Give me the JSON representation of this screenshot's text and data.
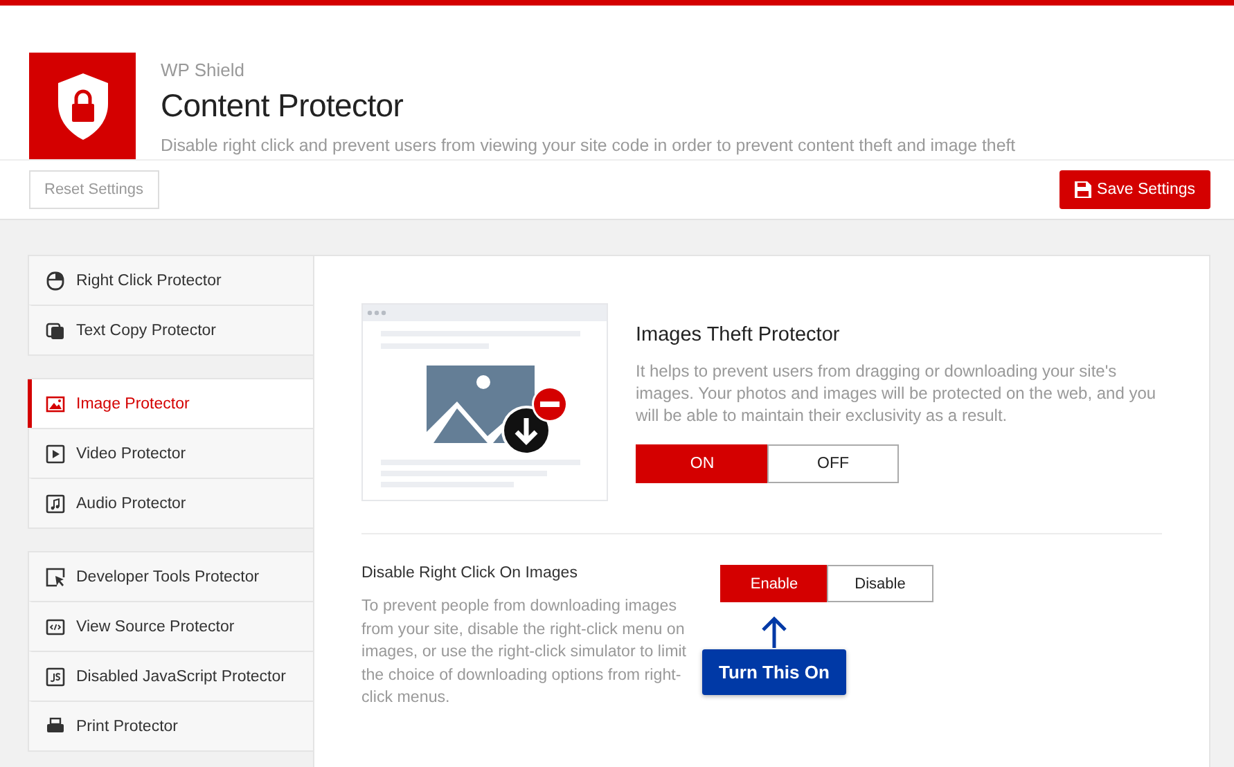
{
  "header": {
    "brand": "WP Shield",
    "title": "Content Protector",
    "subtitle": "Disable right click and prevent users from viewing your site code in order to prevent content theft and image theft"
  },
  "toolbar": {
    "reset_button": "Reset Settings",
    "save_button": "Save Settings"
  },
  "sidebar": {
    "groups": [
      {
        "items": [
          {
            "kind": "mouse",
            "label": "Right Click Protector",
            "selected": false
          },
          {
            "kind": "copy",
            "label": "Text Copy Protector",
            "selected": false
          }
        ]
      },
      {
        "items": [
          {
            "kind": "image",
            "label": "Image Protector",
            "selected": true
          },
          {
            "kind": "video",
            "label": "Video Protector",
            "selected": false
          },
          {
            "kind": "audio",
            "label": "Audio Protector",
            "selected": false
          }
        ]
      },
      {
        "items": [
          {
            "kind": "cursor",
            "label": "Developer Tools Protector",
            "selected": false
          },
          {
            "kind": "code",
            "label": "View Source Protector",
            "selected": false
          },
          {
            "kind": "js",
            "label": "Disabled JavaScript Protector",
            "selected": false
          },
          {
            "kind": "print",
            "label": "Print Protector",
            "selected": false
          }
        ]
      }
    ]
  },
  "feature": {
    "title": "Images Theft Protector",
    "description": "It helps to prevent users from dragging or downloading your site's images. Your photos and images will be protected on the web, and you will be able to maintain their exclusivity as a result.",
    "options": [
      {
        "label": "ON",
        "selected": true
      },
      {
        "label": "OFF",
        "selected": false
      }
    ]
  },
  "setting": {
    "title": "Disable Right Click On Images",
    "description": "To prevent people from downloading images from your site, disable the right-click menu on images, or use the right-click simulator to limit the choice of downloading options from right-click menus.",
    "options": [
      {
        "label": "Enable",
        "selected": true
      },
      {
        "label": "Disable",
        "selected": false
      }
    ]
  },
  "callout": {
    "text": "Turn This On"
  }
}
